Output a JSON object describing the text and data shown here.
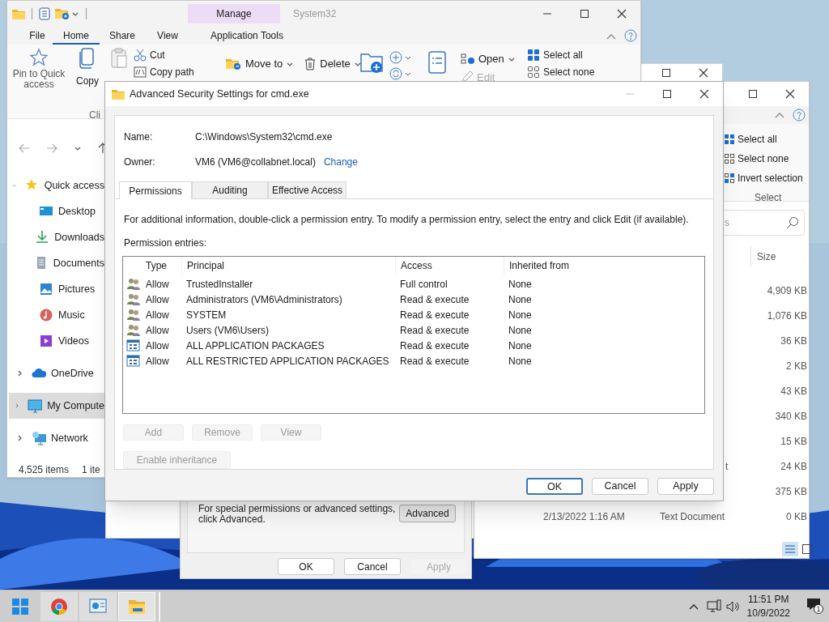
{
  "explorer_back": {
    "context_tab": "Manage",
    "title": "System32",
    "ribbon_tabs": [
      {
        "label": "File",
        "selected": false
      },
      {
        "label": "Home",
        "selected": true
      },
      {
        "label": "Share",
        "selected": false
      },
      {
        "label": "View",
        "selected": false
      },
      {
        "label": "Application Tools",
        "selected": false
      }
    ],
    "clipboard": {
      "pin": "Pin to Quick access",
      "copy": "Copy",
      "cut": "Cut",
      "copy_path": "Copy path",
      "group_label": "Cli"
    },
    "organize": {
      "move_to": "Move to",
      "delete": "Delete"
    },
    "open_group": {
      "open": "Open",
      "edit": {
        "label": "Edit",
        "disabled": true
      }
    },
    "select_group": {
      "select_all": "Select all",
      "select_none": "Select none"
    },
    "nav": [
      {
        "label": "Quick access",
        "kind": "star",
        "expanded": true,
        "selected": false,
        "children": [
          {
            "label": "Desktop",
            "kind": "desktop",
            "selected": false
          },
          {
            "label": "Downloads",
            "kind": "downloads",
            "selected": false
          },
          {
            "label": "Documents",
            "kind": "documents",
            "selected": false
          },
          {
            "label": "Pictures",
            "kind": "pictures",
            "selected": false
          },
          {
            "label": "Music",
            "kind": "music",
            "selected": false
          },
          {
            "label": "Videos",
            "kind": "videos",
            "selected": false
          }
        ]
      },
      {
        "label": "OneDrive",
        "kind": "cloud",
        "expanded": false,
        "selected": false
      },
      {
        "label": "My Compute",
        "kind": "computer",
        "expanded": false,
        "selected": true
      },
      {
        "label": "Network",
        "kind": "network",
        "expanded": false,
        "selected": false
      }
    ],
    "status": {
      "item_count": "4,525 items",
      "selection": "1 ite"
    }
  },
  "explorer_front": {
    "select_all": "Select all",
    "select_none": "Select none",
    "invert_selection": "Invert selection",
    "group_label": "Select",
    "search": {
      "placeholder": "s"
    },
    "size_header": "Size",
    "rows": [
      {
        "size": "4,909 KB"
      },
      {
        "size": "1,076 KB"
      },
      {
        "size": "36 KB"
      },
      {
        "size": "2 KB"
      },
      {
        "size": "43 KB"
      },
      {
        "size": "340 KB"
      },
      {
        "size": "15 KB"
      },
      {
        "type": "t",
        "size": "24 KB"
      },
      {
        "size": "375 KB"
      },
      {
        "date": "2/13/2022 1:16 AM",
        "type": "Text Document",
        "size": "0 KB"
      }
    ]
  },
  "properties_dialog": {
    "note": [
      "For special permissions or advanced settings,",
      "click Advanced."
    ],
    "advanced_button": "Advanced",
    "buttons": [
      {
        "label": "OK",
        "disabled": false
      },
      {
        "label": "Cancel",
        "disabled": false
      },
      {
        "label": "Apply",
        "disabled": true
      }
    ]
  },
  "security_dialog": {
    "title": "Advanced Security Settings for cmd.exe",
    "name_label": "Name:",
    "name_value": "C:\\Windows\\System32\\cmd.exe",
    "owner_label": "Owner:",
    "owner_value": "VM6 (VM6@collabnet.local)",
    "change_link": "Change",
    "tabs": [
      {
        "label": "Permissions",
        "selected": true
      },
      {
        "label": "Auditing",
        "selected": false
      },
      {
        "label": "Effective Access",
        "selected": false
      }
    ],
    "info": "For additional information, double-click a permission entry. To modify a permission entry, select the entry and click Edit (if available).",
    "entries_label": "Permission entries:",
    "columns": [
      "Type",
      "Principal",
      "Access",
      "Inherited from"
    ],
    "rows": [
      {
        "kind": "user",
        "type": "Allow",
        "principal": "TrustedInstaller",
        "access": "Full control",
        "inherited_from": "None"
      },
      {
        "kind": "user",
        "type": "Allow",
        "principal": "Administrators (VM6\\Administrators)",
        "access": "Read & execute",
        "inherited_from": "None"
      },
      {
        "kind": "user",
        "type": "Allow",
        "principal": "SYSTEM",
        "access": "Read & execute",
        "inherited_from": "None"
      },
      {
        "kind": "user",
        "type": "Allow",
        "principal": "Users (VM6\\Users)",
        "access": "Read & execute",
        "inherited_from": "None"
      },
      {
        "kind": "package",
        "type": "Allow",
        "principal": "ALL APPLICATION PACKAGES",
        "access": "Read & execute",
        "inherited_from": "None"
      },
      {
        "kind": "package",
        "type": "Allow",
        "principal": "ALL RESTRICTED APPLICATION PACKAGES",
        "access": "Read & execute",
        "inherited_from": "None"
      }
    ],
    "entry_buttons": [
      {
        "label": "Add",
        "disabled": true
      },
      {
        "label": "Remove",
        "disabled": true
      },
      {
        "label": "View",
        "disabled": true
      }
    ],
    "inheritance_button": {
      "label": "Enable inheritance",
      "disabled": true
    },
    "buttons": [
      {
        "label": "OK",
        "kind": "default"
      },
      {
        "label": "Cancel",
        "kind": "normal"
      },
      {
        "label": "Apply",
        "kind": "normal"
      }
    ]
  },
  "taskbar": {
    "apps": [
      {
        "kind": "start",
        "selected": false
      },
      {
        "kind": "chrome",
        "selected": false
      },
      {
        "kind": "control",
        "selected": false
      },
      {
        "kind": "explorer",
        "selected": true
      }
    ],
    "time": "11:51 PM",
    "date": "10/9/2022",
    "notification_count": "1"
  }
}
